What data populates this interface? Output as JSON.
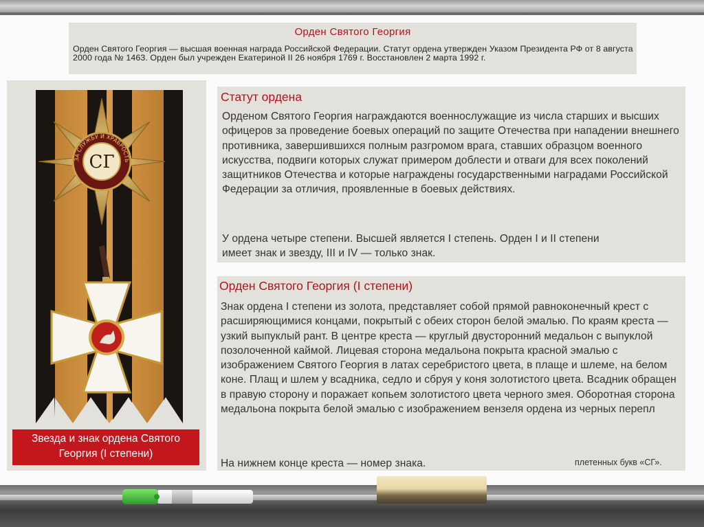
{
  "header": {
    "title": "Орден Святого Георгия",
    "text": "Орден Святого Георгия — высшая военная награда Российской Федерации. Статут ордена утвержден Указом Президента РФ от 8 августа 2000 года № 1463. Орден был учрежден Екатериной II 26 ноября 1769 г. Восстановлен 2 марта 1992 г."
  },
  "left": {
    "caption": "Звезда и знак ордена Святого Георгия (I степени)",
    "star_motto": "ЗА СЛУЖБУ И ХРАБРОСТЬ"
  },
  "statut": {
    "title": "Статут ордена",
    "paragraph1": "Орденом Святого Георгия награждаются военнослужащие из числа старших и высших офицеров за проведение боевых операций по защите Отечества при нападении внешнего противника, завершившихся полным разгромом врага, ставших образцом военного искусства, подвиги которых служат примером доблести и отваги для всех поколений защитников Отечества и которые награждены государственными наградами Российской Федерации за отличия, проявленные в боевых действиях.",
    "paragraph2": "У ордена четыре степени. Высшей является I степень. Орден I и II степени имеет знак и звезду, III и IV — только знак."
  },
  "degree": {
    "title": "Орден Святого Георгия (I степени)",
    "text": "Знак ордена I степени из золота, представляет собой прямой равноконечный крест с расширяющимися концами, покрытый с обеих сторон белой эмалью. По краям креста — узкий выпуклый рант. В центре креста — круглый двусторонний медальон с выпуклой позолоченной каймой. Лицевая сторона медальона покрыта красной эмалью с изображением Святого Георгия в латах серебристого цвета, в плаще и шлеме, на белом коне. Плащ и шлем у всадника, седло и сбруя у коня золотистого цвета. Всадник обращен в правую сторону и поражает копьем золотистого цвета черного змея. Оборотная сторона медальона покрыта белой эмалью с изображением вензеля ордена из черных перепл",
    "last_line": "На нижнем конце креста — номер знака.",
    "overflow_tail": "плетенных букв «СГ»."
  }
}
